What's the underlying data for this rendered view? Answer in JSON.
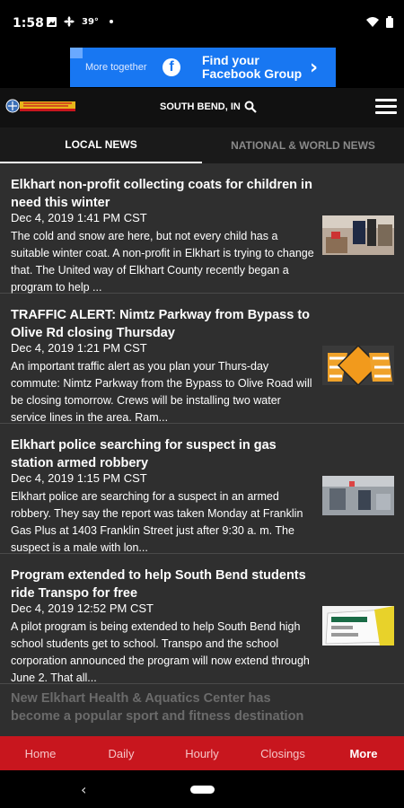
{
  "status": {
    "time": "1:58",
    "temp": "39°"
  },
  "ad": {
    "small_text": "More together",
    "main_text": "Find your Facebook Group",
    "fb_letter": "f",
    "arrow": "›"
  },
  "header": {
    "location": "SOUTH BEND, IN"
  },
  "tabs": [
    {
      "label": "LOCAL NEWS"
    },
    {
      "label": "NATIONAL & WORLD NEWS"
    }
  ],
  "articles": [
    {
      "title": "Elkhart non-profit collecting coats for children in need this winter",
      "date": "Dec 4, 2019 1:41 PM CST",
      "body": "The cold and snow are here, but not every child has a suitable winter coat. A non-profit in Elkhart is trying to change that. The United way of Elkhart County recently began a program to help ...",
      "thumb": "coats"
    },
    {
      "title": "TRAFFIC ALERT: Nimtz Parkway from Bypass to Olive Rd closing Thursday",
      "date": "Dec 4, 2019 1:21 PM CST",
      "body": "An important traffic alert as you plan your Thurs-day commute: Nimtz Parkway from the Bypass to Olive Road will be closing tomorrow. Crews will be installing two water service lines in the area. Ram...",
      "thumb": "road-work"
    },
    {
      "title": "Elkhart police searching for suspect in gas station armed robbery",
      "date": "Dec 4, 2019 1:15 PM CST",
      "body": "Elkhart police are searching for a suspect in an armed robbery. They say the report was taken Monday at Franklin Gas Plus at 1403 Franklin Street just after 9:30 a. m. The suspect is a male with lon...",
      "thumb": "surveillance"
    },
    {
      "title": "Program extended to help South Bend students ride Transpo for free",
      "date": "Dec 4, 2019 12:52 PM CST",
      "body": "A pilot program is being extended to help South Bend high school students get to school. Transpo and the school corporation announced the program will now extend through June 2. That all...",
      "thumb": "bus"
    }
  ],
  "partial_article": {
    "title": "New Elkhart Health & Aquatics Center has become a popular sport and fitness destination"
  },
  "bottom_nav": [
    {
      "label": "Home"
    },
    {
      "label": "Daily"
    },
    {
      "label": "Hourly"
    },
    {
      "label": "Closings"
    },
    {
      "label": "More"
    }
  ],
  "system_nav": {
    "back": "‹"
  },
  "colors": {
    "nav_red": "#c8161e",
    "ad_blue": "#1877f2",
    "list_bg": "#2f2f2f"
  }
}
